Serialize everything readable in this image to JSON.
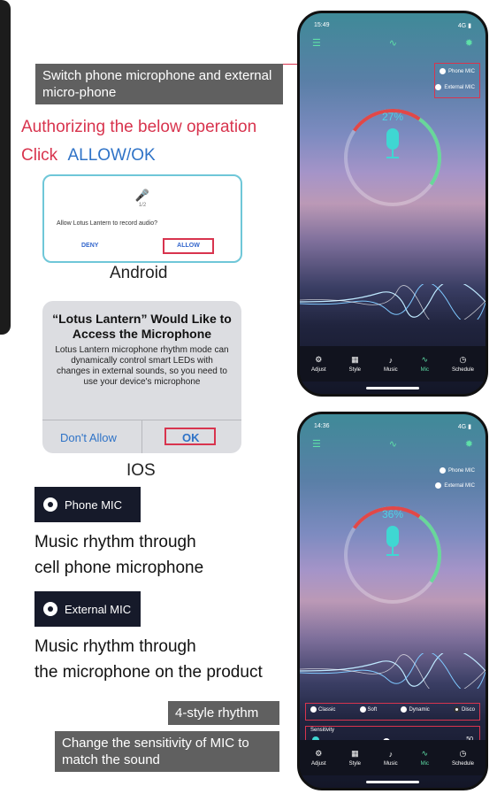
{
  "callouts": {
    "switch_mic": "Switch phone microphone and external micro-phone",
    "style_rhythm": "4-style rhythm",
    "sensitivity": "Change the sensitivity of MIC to match the sound"
  },
  "auth": {
    "line1": "Authorizing the below operation",
    "click": "Click",
    "allow_ok": "ALLOW/OK"
  },
  "android": {
    "mic_caption": "1/2",
    "question": "Allow Lotus Lantern to record audio?",
    "deny": "DENY",
    "allow": "ALLOW",
    "label": "Android"
  },
  "ios": {
    "title": "“Lotus Lantern” Would Like to Access the Microphone",
    "body": "Lotus Lantern microphone rhythm mode can dynamically control smart LEDs with changes in external sounds, so you need to use your device's microphone",
    "dont_allow": "Don't Allow",
    "ok": "OK",
    "label": "IOS"
  },
  "modes": {
    "phone_mic": "Phone MIC",
    "phone_desc_1": "Music rhythm through",
    "phone_desc_2": "cell phone microphone",
    "external_mic": "External MIC",
    "external_desc_1": "Music rhythm through",
    "external_desc_2": "the microphone on the product"
  },
  "phone1": {
    "time": "15:49",
    "signal": "4G",
    "opt_phone": "Phone MIC",
    "opt_external": "External MIC",
    "percent": "27%",
    "nav": [
      "Adjust",
      "Style",
      "Music",
      "Mic",
      "Schedule"
    ]
  },
  "phone2": {
    "time": "14:36",
    "signal": "4G",
    "opt_phone": "Phone MIC",
    "opt_external": "External MIC",
    "percent": "36%",
    "styles": [
      "Classic",
      "Soft",
      "Dynamic",
      "Disco"
    ],
    "sensitivity_label": "Sensitivity",
    "sensitivity_value": "50",
    "sensitivity_level": 0.45,
    "nav": [
      "Adjust",
      "Style",
      "Music",
      "Mic",
      "Schedule"
    ]
  },
  "colors": {
    "accent_red": "#d8344e",
    "accent_blue": "#2f73c7",
    "mic_teal": "#3fd7d2",
    "active_green": "#5fe0a8"
  }
}
